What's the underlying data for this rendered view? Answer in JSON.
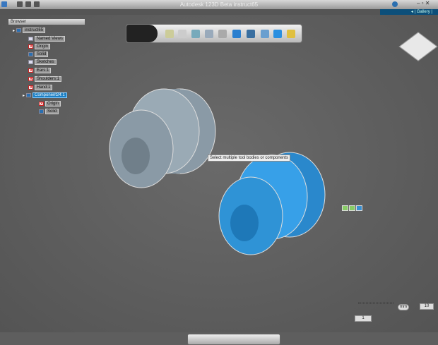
{
  "window": {
    "title": "Autodesk 123D Beta   instruct65"
  },
  "gallery": {
    "label": "◂ | Gallery |"
  },
  "browser": {
    "title": "Browser",
    "nodes": [
      {
        "label": "instruct65",
        "icon": "document-icon"
      },
      {
        "label": "Named Views",
        "icon": "folder-icon"
      },
      {
        "label": "Origin",
        "icon": "hidden-folder-icon"
      },
      {
        "label": "Solid",
        "icon": "visible-body-icon"
      },
      {
        "label": "Sketches",
        "icon": "folder-icon"
      },
      {
        "label": "Ears:1",
        "icon": "hidden-component-icon"
      },
      {
        "label": "Shoulders:1",
        "icon": "hidden-component-icon"
      },
      {
        "label": "Hand:1",
        "icon": "hidden-component-icon"
      },
      {
        "label": "Component24:1",
        "icon": "component-icon"
      },
      {
        "label": "Origin",
        "icon": "hidden-folder-icon"
      },
      {
        "label": "Solid",
        "icon": "visible-body-icon"
      }
    ]
  },
  "tooltip": "Select multiple tool bodies or components",
  "grid": {
    "unit": "mm",
    "value": "10",
    "snap": "1"
  },
  "colors": {
    "selected": "#2f93d6",
    "body": "#8a9aa6",
    "gallery": "#0c4f7a"
  }
}
